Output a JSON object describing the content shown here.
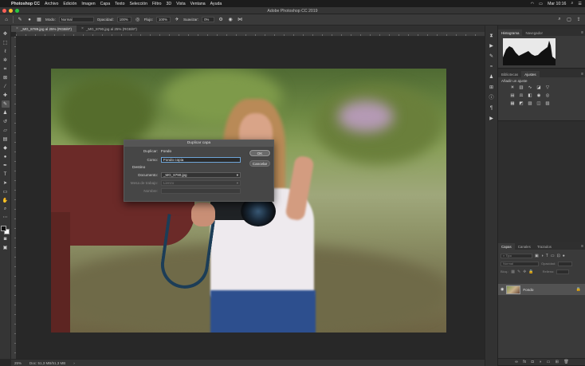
{
  "menubar": {
    "app_name": "Photoshop CC",
    "items": [
      "Archivo",
      "Edición",
      "Imagen",
      "Capa",
      "Texto",
      "Selección",
      "Filtro",
      "3D",
      "Vista",
      "Ventana",
      "Ayuda"
    ],
    "clock": "Mar 10:16"
  },
  "window": {
    "title": "Adobe Photoshop CC 2019",
    "traffic_colors": [
      "#fe5f57",
      "#febc2e",
      "#28c840"
    ]
  },
  "options_bar": {
    "mode_label": "Modo:",
    "mode_value": "Normal",
    "opacity_label": "Opacidad:",
    "opacity_value": "100%",
    "flow_label": "Flujo:",
    "flow_value": "100%",
    "smoothing_label": "Suavizar:",
    "smoothing_value": "0%"
  },
  "tabs": [
    {
      "label": "_MG_8789.jpg al 25% (RGB/8*)",
      "active": true
    },
    {
      "label": "_MG_8790.jpg al 25% (RGB/8*)",
      "active": false
    }
  ],
  "dialog": {
    "title": "Duplicar capa",
    "duplicate_label": "Duplicar:",
    "duplicate_value": "Fondo",
    "as_label": "Como:",
    "as_value": "Fondo copia",
    "destination_label": "Destino",
    "document_label": "Documento:",
    "document_value": "_MG_8790.jpg",
    "artboard_label": "Mesa de trabajo:",
    "artboard_value": "Lienzo",
    "name_label": "Nombre:",
    "ok_label": "OK",
    "cancel_label": "Cancelar"
  },
  "statusbar": {
    "zoom": "25%",
    "doc_info": "Doc: 51,3 MB/51,3 MB"
  },
  "panels": {
    "histogram_tabs": [
      "Histograma",
      "Navegador"
    ],
    "adjustments_tabs": [
      "Bibliotecas",
      "Ajustes"
    ],
    "adjustments_title": "Añadir un ajuste",
    "layers_tabs": [
      "Capas",
      "Canales",
      "Trazados"
    ],
    "layers_kind_label": "Tipo",
    "layers_blend_label": "Normal",
    "layers_opacity_label": "Opacidad:",
    "layers_lock_label": "Bloq.:",
    "layers_fill_label": "Relleno:",
    "layer_name": "Fondo"
  },
  "colors": {
    "accent_blue": "#6ea5d8",
    "foreground_swatch": "#111111",
    "background_swatch": "#ffffff"
  }
}
